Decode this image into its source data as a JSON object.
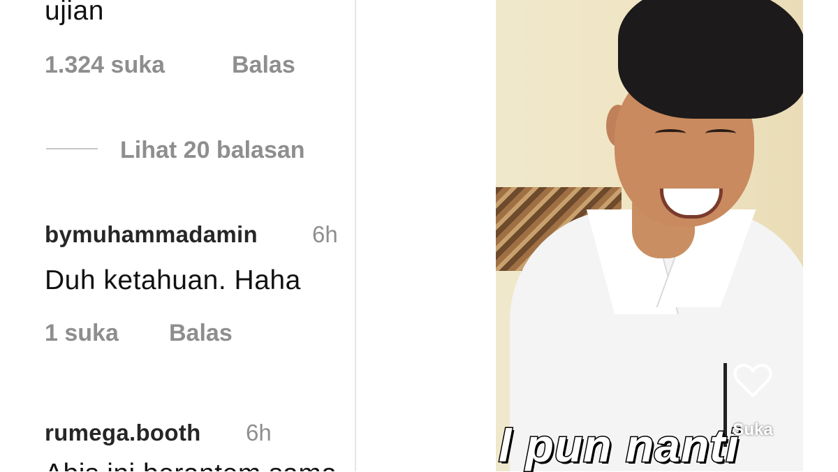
{
  "comments": [
    {
      "text": "ujian",
      "likes": "1.324 suka",
      "reply": "Balas",
      "view_replies": "Lihat 20 balasan"
    },
    {
      "username": "bymuhammadamin",
      "time": "6h",
      "text": "Duh ketahuan. Haha",
      "likes": "1 suka",
      "reply": "Balas"
    },
    {
      "username": "rumega.booth",
      "time": "6h",
      "text": "Abis ini berantem sama"
    }
  ],
  "video": {
    "caption": "l pun nanti",
    "like_label": "Suka",
    "like_icon": "heart-outline-icon"
  },
  "colors": {
    "meta_text": "#8e8e8e",
    "body_text": "#111111"
  }
}
